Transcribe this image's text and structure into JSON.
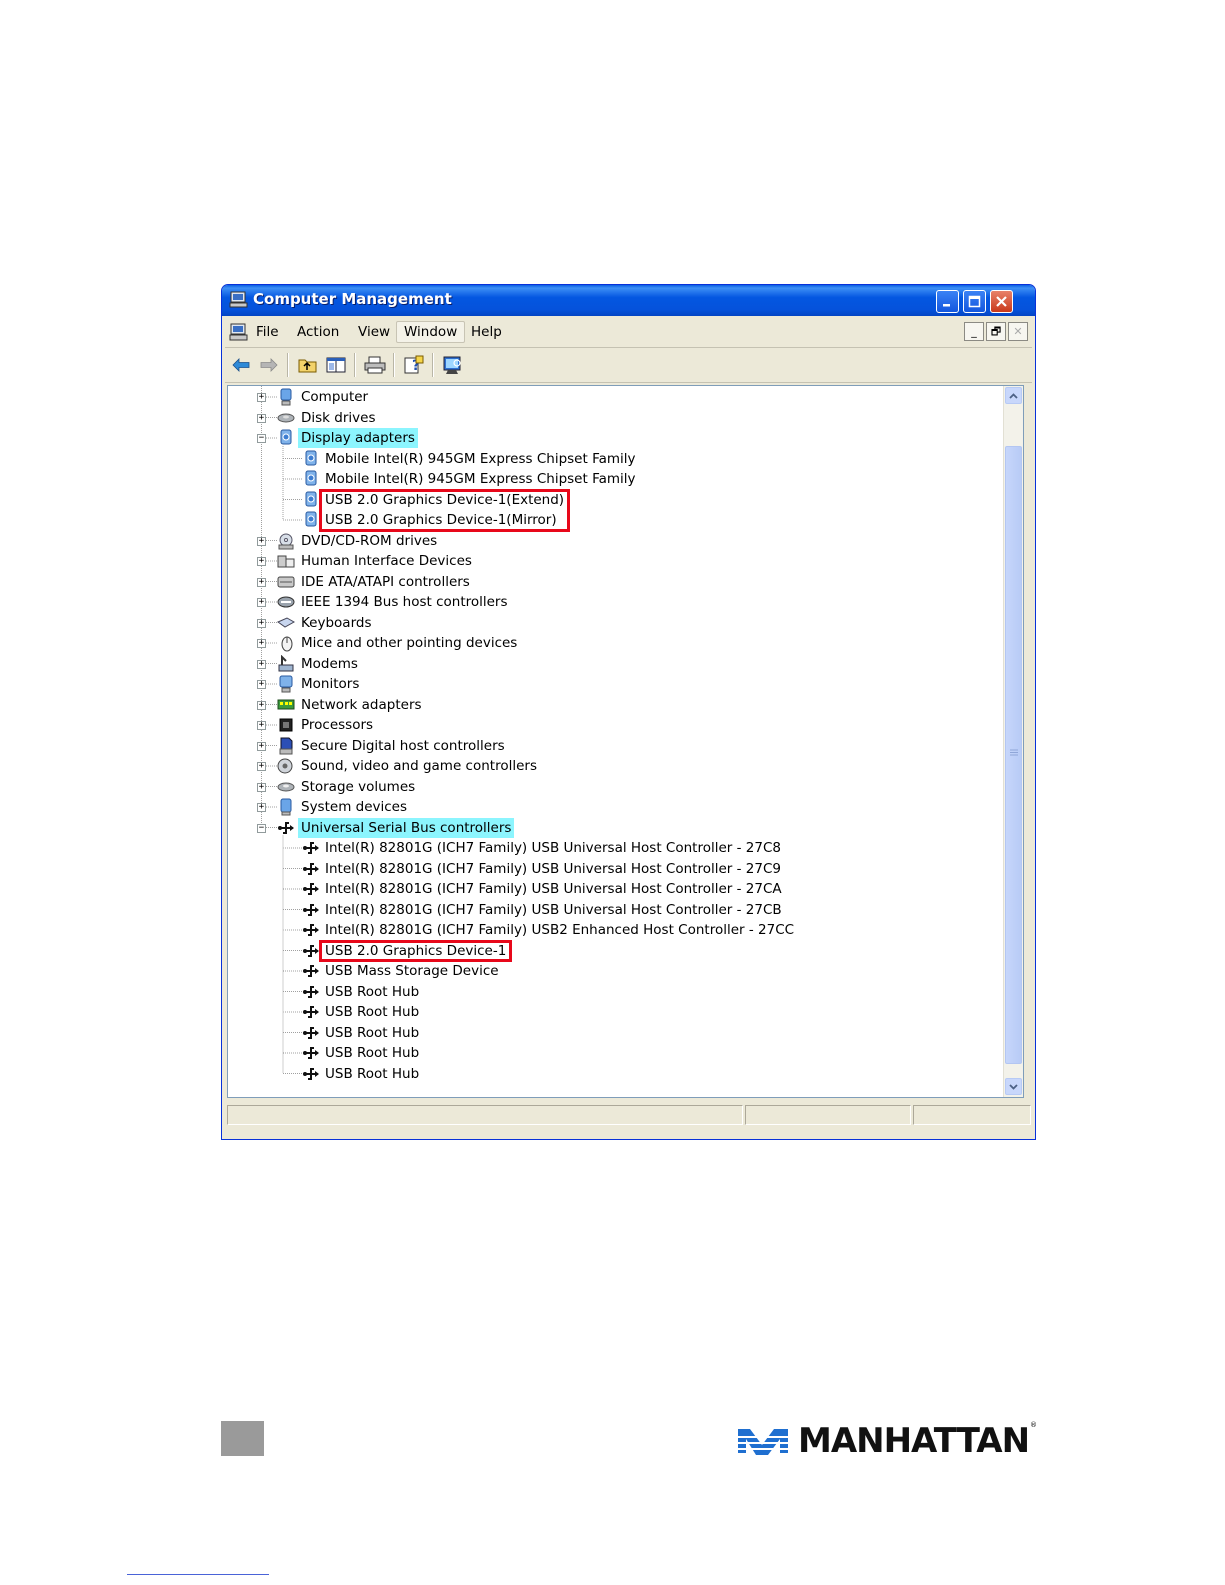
{
  "window": {
    "title": "Computer Management"
  },
  "menu": [
    "File",
    "Action",
    "View",
    "Window",
    "Help"
  ],
  "mdi_buttons": [
    "_",
    "🗗",
    "✕"
  ],
  "tree": [
    {
      "label": "Computer",
      "level": 0,
      "expander": "+",
      "icon": "computer-icon"
    },
    {
      "label": "Disk drives",
      "level": 0,
      "expander": "+",
      "icon": "disk-drive-icon"
    },
    {
      "label": "Display adapters",
      "level": 0,
      "expander": "-",
      "icon": "display-adapter-icon",
      "highlight": true
    },
    {
      "label": "Mobile Intel(R) 945GM Express Chipset Family",
      "level": 1,
      "icon": "display-adapter-icon"
    },
    {
      "label": "Mobile Intel(R) 945GM Express Chipset Family",
      "level": 1,
      "icon": "display-adapter-icon"
    },
    {
      "label": "USB 2.0 Graphics Device-1(Extend)",
      "level": 1,
      "icon": "display-adapter-icon"
    },
    {
      "label": "USB 2.0 Graphics Device-1(Mirror)",
      "level": 1,
      "icon": "display-adapter-icon"
    },
    {
      "label": "DVD/CD-ROM drives",
      "level": 0,
      "expander": "+",
      "icon": "cdrom-icon"
    },
    {
      "label": "Human Interface Devices",
      "level": 0,
      "expander": "+",
      "icon": "hid-icon"
    },
    {
      "label": "IDE ATA/ATAPI controllers",
      "level": 0,
      "expander": "+",
      "icon": "ide-controller-icon"
    },
    {
      "label": "IEEE 1394 Bus host controllers",
      "level": 0,
      "expander": "+",
      "icon": "ieee1394-icon"
    },
    {
      "label": "Keyboards",
      "level": 0,
      "expander": "+",
      "icon": "keyboard-icon"
    },
    {
      "label": "Mice and other pointing devices",
      "level": 0,
      "expander": "+",
      "icon": "mouse-icon"
    },
    {
      "label": "Modems",
      "level": 0,
      "expander": "+",
      "icon": "modem-icon"
    },
    {
      "label": "Monitors",
      "level": 0,
      "expander": "+",
      "icon": "monitor-icon"
    },
    {
      "label": "Network adapters",
      "level": 0,
      "expander": "+",
      "icon": "network-adapter-icon"
    },
    {
      "label": "Processors",
      "level": 0,
      "expander": "+",
      "icon": "processor-icon"
    },
    {
      "label": "Secure Digital host controllers",
      "level": 0,
      "expander": "+",
      "icon": "sd-controller-icon"
    },
    {
      "label": "Sound, video and game controllers",
      "level": 0,
      "expander": "+",
      "icon": "sound-icon"
    },
    {
      "label": "Storage volumes",
      "level": 0,
      "expander": "+",
      "icon": "storage-volume-icon"
    },
    {
      "label": "System devices",
      "level": 0,
      "expander": "+",
      "icon": "system-device-icon"
    },
    {
      "label": "Universal Serial Bus controllers",
      "level": 0,
      "expander": "-",
      "icon": "usb-icon",
      "highlight": true
    },
    {
      "label": "Intel(R) 82801G (ICH7 Family) USB Universal Host Controller - 27C8",
      "level": 1,
      "icon": "usb-icon"
    },
    {
      "label": "Intel(R) 82801G (ICH7 Family) USB Universal Host Controller - 27C9",
      "level": 1,
      "icon": "usb-icon"
    },
    {
      "label": "Intel(R) 82801G (ICH7 Family) USB Universal Host Controller - 27CA",
      "level": 1,
      "icon": "usb-icon"
    },
    {
      "label": "Intel(R) 82801G (ICH7 Family) USB Universal Host Controller - 27CB",
      "level": 1,
      "icon": "usb-icon"
    },
    {
      "label": "Intel(R) 82801G (ICH7 Family) USB2 Enhanced Host Controller - 27CC",
      "level": 1,
      "icon": "usb-icon"
    },
    {
      "label": "USB 2.0 Graphics Device-1",
      "level": 1,
      "icon": "usb-icon"
    },
    {
      "label": "USB Mass Storage Device",
      "level": 1,
      "icon": "usb-icon"
    },
    {
      "label": "USB Root Hub",
      "level": 1,
      "icon": "usb-icon"
    },
    {
      "label": "USB Root Hub",
      "level": 1,
      "icon": "usb-icon"
    },
    {
      "label": "USB Root Hub",
      "level": 1,
      "icon": "usb-icon"
    },
    {
      "label": "USB Root Hub",
      "level": 1,
      "icon": "usb-icon"
    },
    {
      "label": "USB Root Hub",
      "level": 1,
      "icon": "usb-icon"
    }
  ],
  "callouts": [
    {
      "rows": [
        5,
        6
      ]
    },
    {
      "rows": [
        27,
        27
      ]
    }
  ],
  "logo": {
    "text": "MANHATTAN",
    "trademark": "®",
    "color": "#1f6fd0"
  },
  "colors": {
    "highlight": "#8cf5fe",
    "callout": "#e8081a",
    "titlebar": "#0457e1"
  }
}
